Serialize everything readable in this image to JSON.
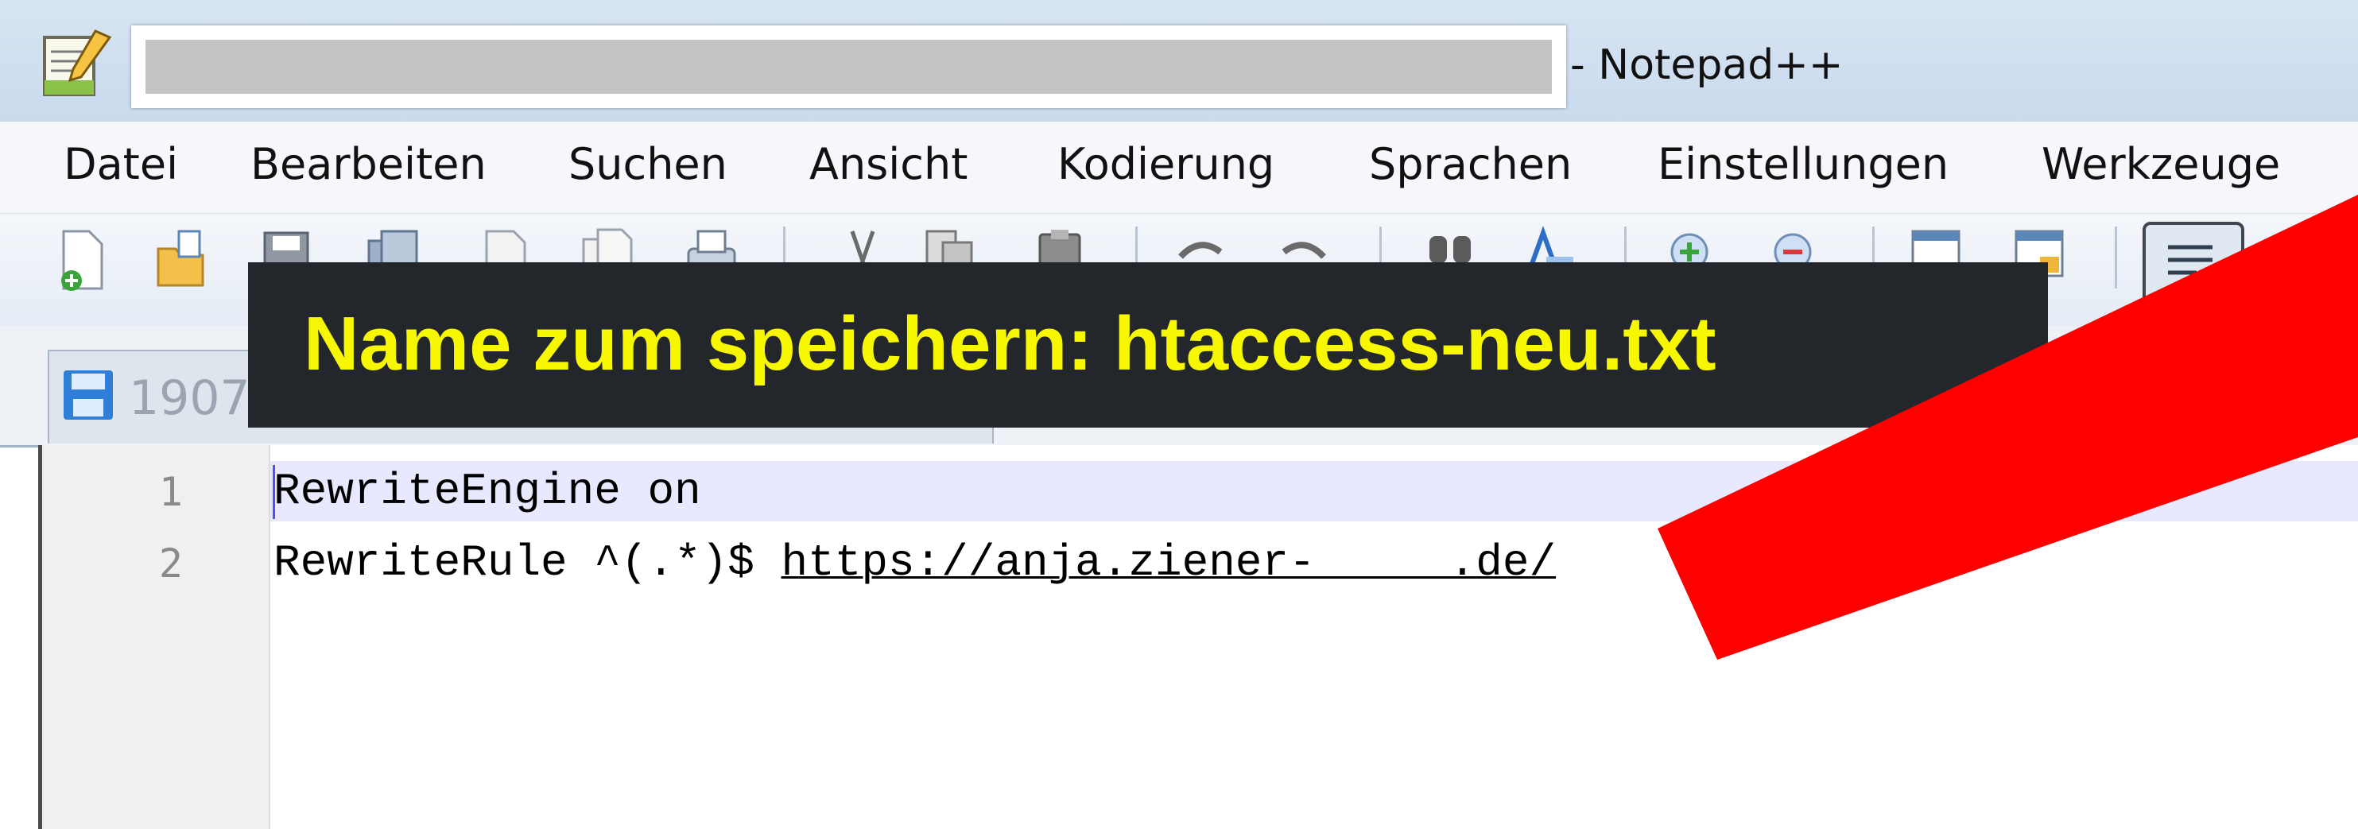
{
  "window": {
    "title": "- Notepad++",
    "title_redacted": true
  },
  "menu": {
    "items": [
      "Datei",
      "Bearbeiten",
      "Suchen",
      "Ansicht",
      "Kodierung",
      "Sprachen",
      "Einstellungen",
      "Werkzeuge"
    ]
  },
  "toolbar": {
    "icons": [
      "new-file-icon",
      "open-file-icon",
      "save-icon",
      "save-all-icon",
      "close-icon",
      "close-all-icon",
      "print-icon",
      "cut-icon",
      "copy-icon",
      "paste-icon",
      "undo-icon",
      "redo-icon",
      "find-icon",
      "replace-icon",
      "zoom-in-icon",
      "zoom-out-icon",
      "sync-vertical-icon",
      "sync-horizontal-icon",
      "word-wrap-icon",
      "show-all-characters-icon"
    ]
  },
  "tab": {
    "label": "1907",
    "icon": "save-icon"
  },
  "editor": {
    "lines": [
      {
        "number": "1",
        "text": "RewriteEngine on",
        "link": ""
      },
      {
        "number": "2",
        "text": "RewriteRule ^(.*)$ ",
        "link": "https://anja.ziener-     .de/"
      }
    ],
    "current_line_color": "#e8e8ff"
  },
  "annotation": {
    "banner_text": "Name zum speichern: htaccess-neu.txt",
    "banner_text_color": "#f7f700",
    "banner_background": "#23272b",
    "strike_color": "#ff0000"
  }
}
